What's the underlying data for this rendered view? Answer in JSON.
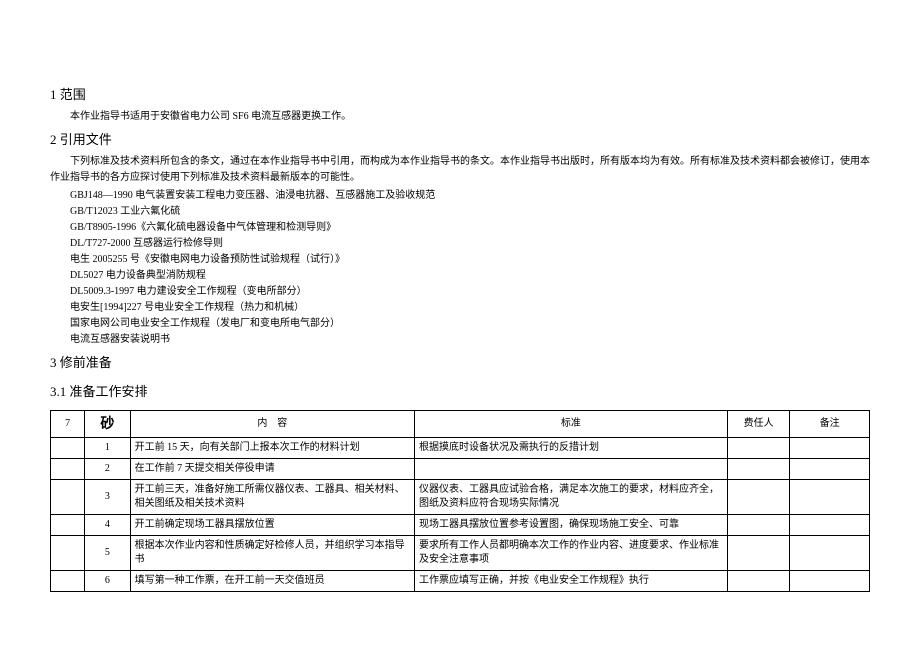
{
  "sections": {
    "s1": {
      "title": "1 范围",
      "text": "本作业指导书适用于安徽省电力公司 SF6 电流互感器更换工作。"
    },
    "s2": {
      "title": "2 引用文件",
      "intro": "下列标准及技术资料所包含的条文，通过在本作业指导书中引用，而构成为本作业指导书的条文。本作业指导书出版时，所有版本均为有效。所有标准及技术资料都会被修订，使用本作业指导书的各方应探讨使用下列标准及技术资料最新版本的可能性。",
      "refs": [
        "GBJ148—1990 电气装置安装工程电力变压器、油浸电抗器、互感器施工及验收规范",
        "GB/T12023 工业六氟化硫",
        "GB/T8905-1996《六氟化硫电器设备中气体管理和检测导则》",
        "DL/T727-2000 互感器运行检修导则",
        "电生 2005255 号《安徽电网电力设备预防性试验规程（试行）》",
        "DL5027 电力设备典型消防规程",
        "DL5009.3-1997 电力建设安全工作规程（变电所部分）",
        "电安生[1994]227 号电业安全工作规程（热力和机械）",
        "国家电网公司电业安全工作规程（发电厂和变电所电气部分）",
        "电流互感器安装说明书"
      ]
    },
    "s3": {
      "title": "3 修前准备"
    },
    "s31": {
      "title": "3.1 准备工作安排"
    }
  },
  "table": {
    "headers": {
      "c1": "7",
      "c2": "砂",
      "c3": "内　容",
      "c4": "标准",
      "c5": "费任人",
      "c6": "备注"
    },
    "rows": [
      {
        "no": "1",
        "content": "开工前 15 天，向有关部门上报本次工作的材料计划",
        "standard": "根据摸底时设备状况及需执行的反措计划",
        "resp": "",
        "remark": ""
      },
      {
        "no": "2",
        "content": "在工作前 7 天提交相关停役申请",
        "standard": "",
        "resp": "",
        "remark": ""
      },
      {
        "no": "3",
        "content": "开工前三天，准备好施工所需仪器仪表、工器具、相关材料、相关图纸及相关技术资料",
        "standard": "仪器仪表、工器具应试验合格，满足本次施工的要求，材料应齐全，图纸及资料应符合现场实际情况",
        "resp": "",
        "remark": ""
      },
      {
        "no": "4",
        "content": "开工前确定现场工器具摆放位置",
        "standard": "现场工器具摆放位置参考设置图，确保现场施工安全、可靠",
        "resp": "",
        "remark": ""
      },
      {
        "no": "5",
        "content": "根据本次作业内容和性质确定好检修人员，并组织学习本指导书",
        "standard": "要求所有工作人员都明确本次工作的作业内容、进度要求、作业标准及安全注意事项",
        "resp": "",
        "remark": ""
      },
      {
        "no": "6",
        "content": "填写第一种工作票，在开工前一天交值班员",
        "standard": "工作票应填写正确，并按《电业安全工作规程》执行",
        "resp": "",
        "remark": ""
      }
    ]
  }
}
